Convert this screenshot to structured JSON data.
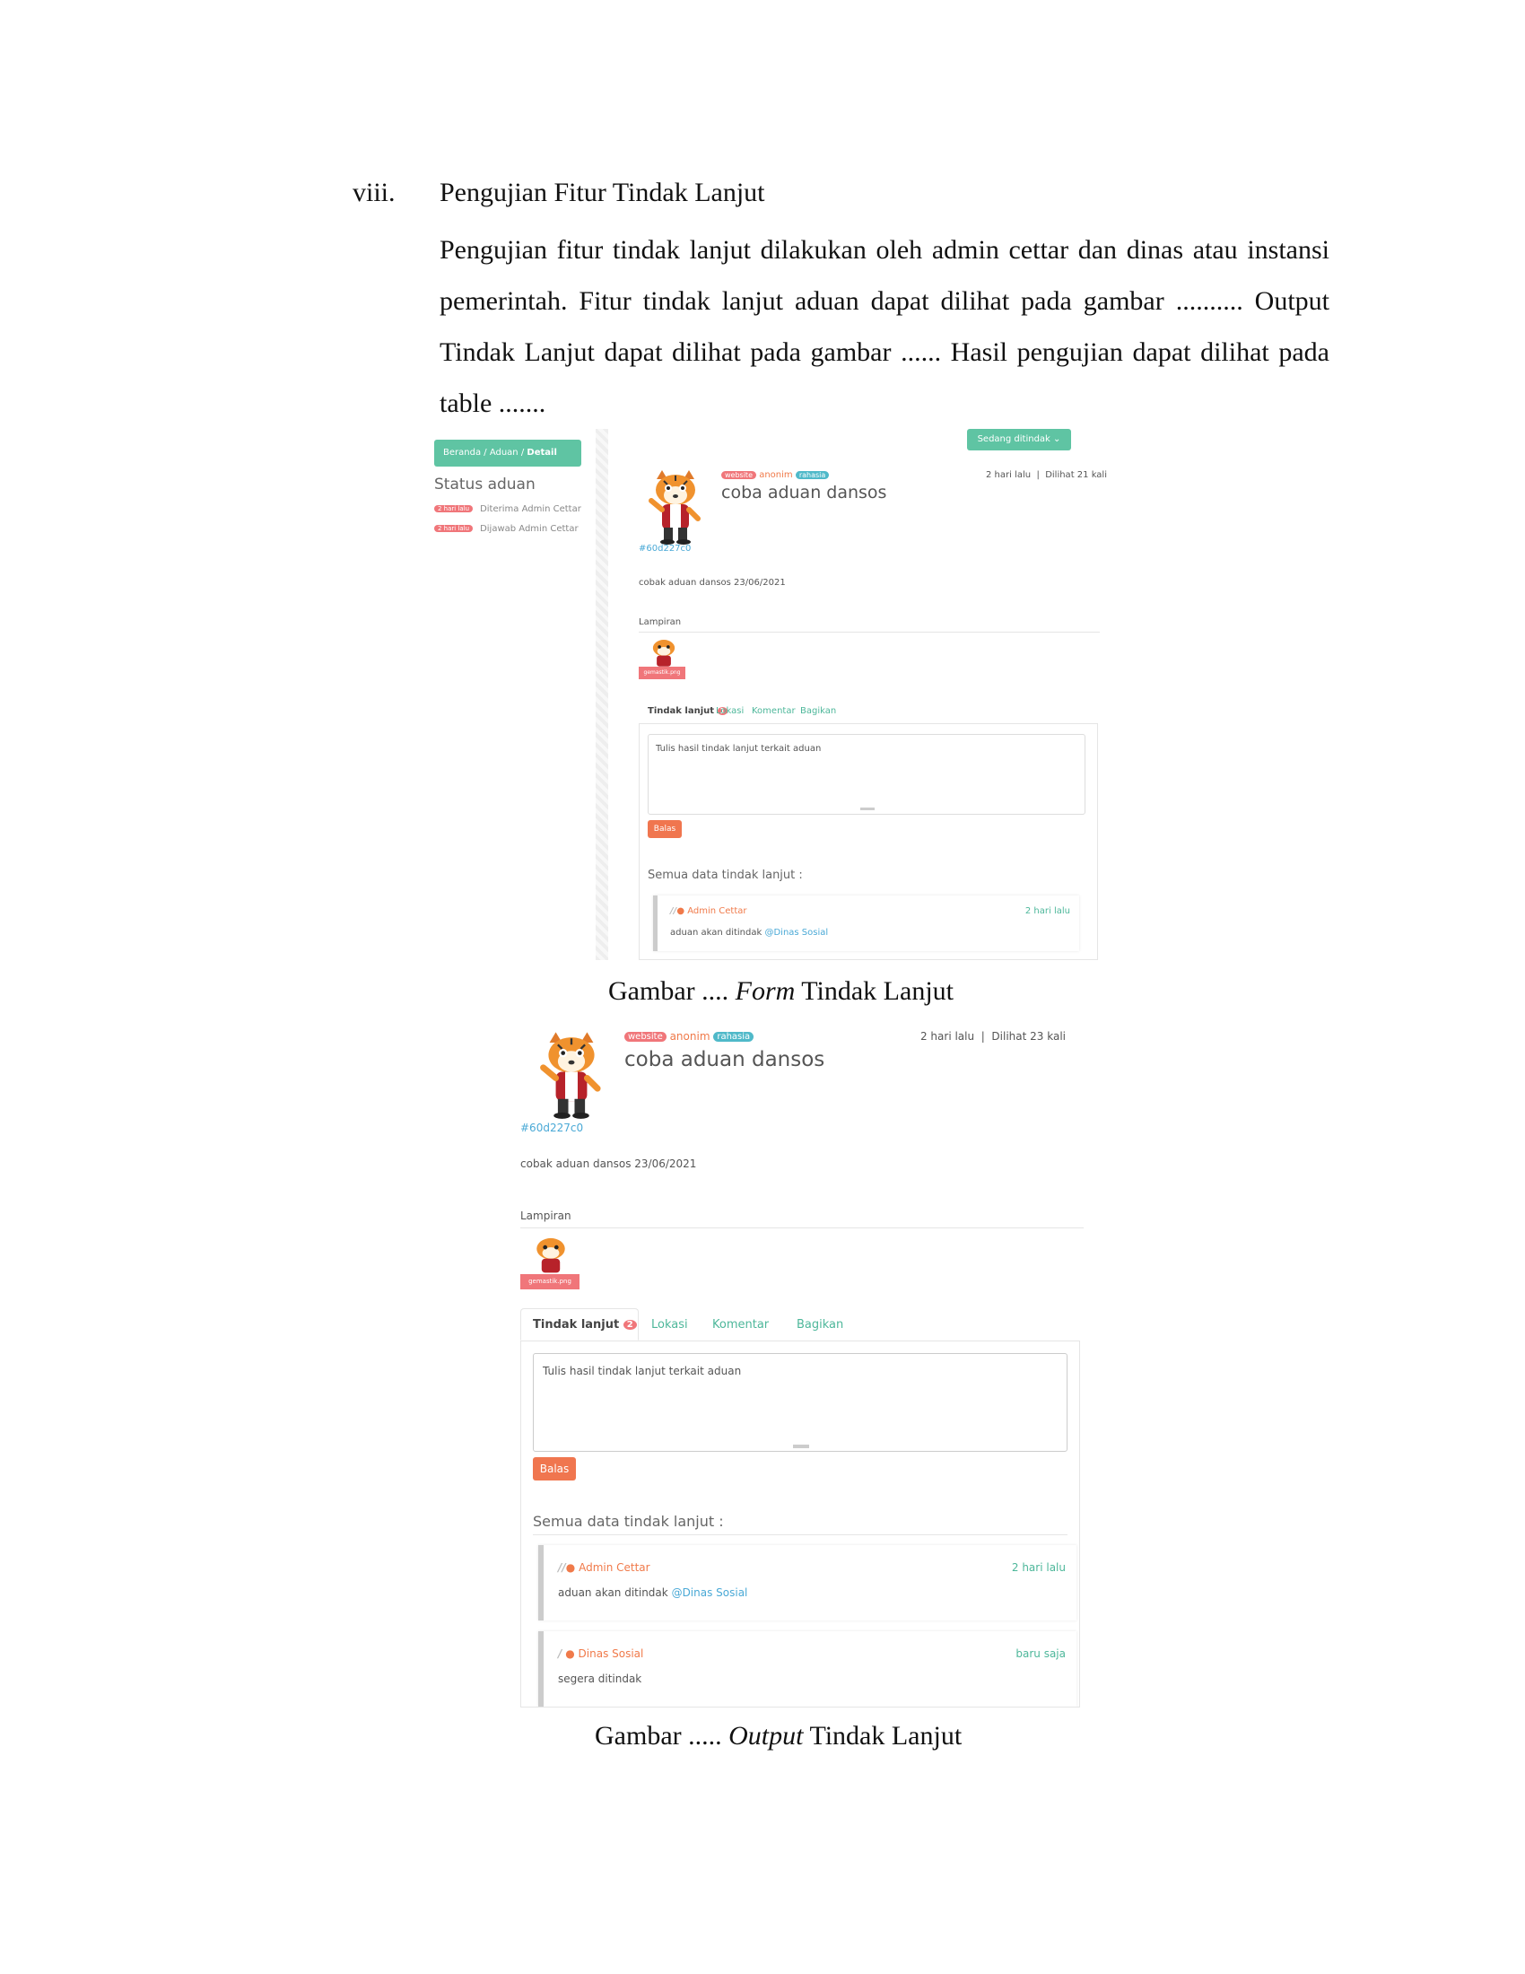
{
  "doc": {
    "heading_num": "viii.",
    "heading_title": "Pengujian Fitur Tindak Lanjut",
    "paragraph": "Pengujian fitur tindak lanjut dilakukan oleh admin cettar dan dinas atau instansi pemerintah. Fitur tindak lanjut aduan dapat dilihat pada gambar .......... Output Tindak Lanjut dapat dilihat pada gambar ...... Hasil pengujian dapat dilihat pada table .......",
    "caption1_prefix": "Gambar ....",
    "caption1_em": "Form",
    "caption1_suffix": "Tindak Lanjut",
    "caption2_prefix": "Gambar .....",
    "caption2_em": "Output",
    "caption2_suffix": "Tindak Lanjut"
  },
  "form": {
    "breadcrumb": {
      "home": "Beranda",
      "sep": "/",
      "aduan": "Aduan",
      "detail": "Detail"
    },
    "status_title": "Status aduan",
    "status_items": [
      {
        "badge": "2 hari lalu",
        "text": "Diterima Admin Cettar"
      },
      {
        "badge": "2 hari lalu",
        "text": "Dijawab Admin Cettar"
      }
    ],
    "state_button": "Sedang ditindak",
    "tag_source": "website",
    "tag_user": "anonim",
    "tag_private": "rahasia",
    "time": "2 hari lalu",
    "views": "Dilihat 21 kali",
    "title": "coba aduan dansos",
    "id": "#60d227c0",
    "description": "cobak aduan dansos 23/06/2021",
    "lampiran": "Lampiran",
    "file_name": "gemastik.png",
    "tabs": [
      "Tindak lanjut",
      "Lokasi",
      "Komentar",
      "Bagikan"
    ],
    "tab_count": "1",
    "placeholder": "Tulis hasil tindak lanjut terkait aduan",
    "send": "Balas",
    "all_label": "Semua data tindak lanjut :",
    "entries": [
      {
        "author": "Admin Cettar",
        "time": "2 hari lalu",
        "message": "aduan akan ditindak",
        "mention": "@Dinas Sosial"
      }
    ]
  },
  "output": {
    "tag_source": "website",
    "tag_user": "anonim",
    "tag_private": "rahasia",
    "time": "2 hari lalu",
    "views": "Dilihat 23 kali",
    "title": "coba aduan dansos",
    "id": "#60d227c0",
    "description": "cobak aduan dansos 23/06/2021",
    "lampiran": "Lampiran",
    "file_name": "gemastik.png",
    "tabs": [
      "Tindak lanjut",
      "Lokasi",
      "Komentar",
      "Bagikan"
    ],
    "tab_count": "2",
    "placeholder": "Tulis hasil tindak lanjut terkait aduan",
    "send": "Balas",
    "all_label": "Semua data tindak lanjut :",
    "entries": [
      {
        "author": "Admin Cettar",
        "time": "2 hari lalu",
        "message": "aduan akan ditindak",
        "mention": "@Dinas Sosial"
      },
      {
        "author": "Dinas Sosial",
        "time": "baru saja",
        "message": "segera ditindak",
        "mention": ""
      }
    ]
  },
  "colors": {
    "teal": "#5fc4a3",
    "orange": "#f0764f",
    "badge_red": "#f0767a",
    "badge_blue": "#4fb9c9"
  }
}
